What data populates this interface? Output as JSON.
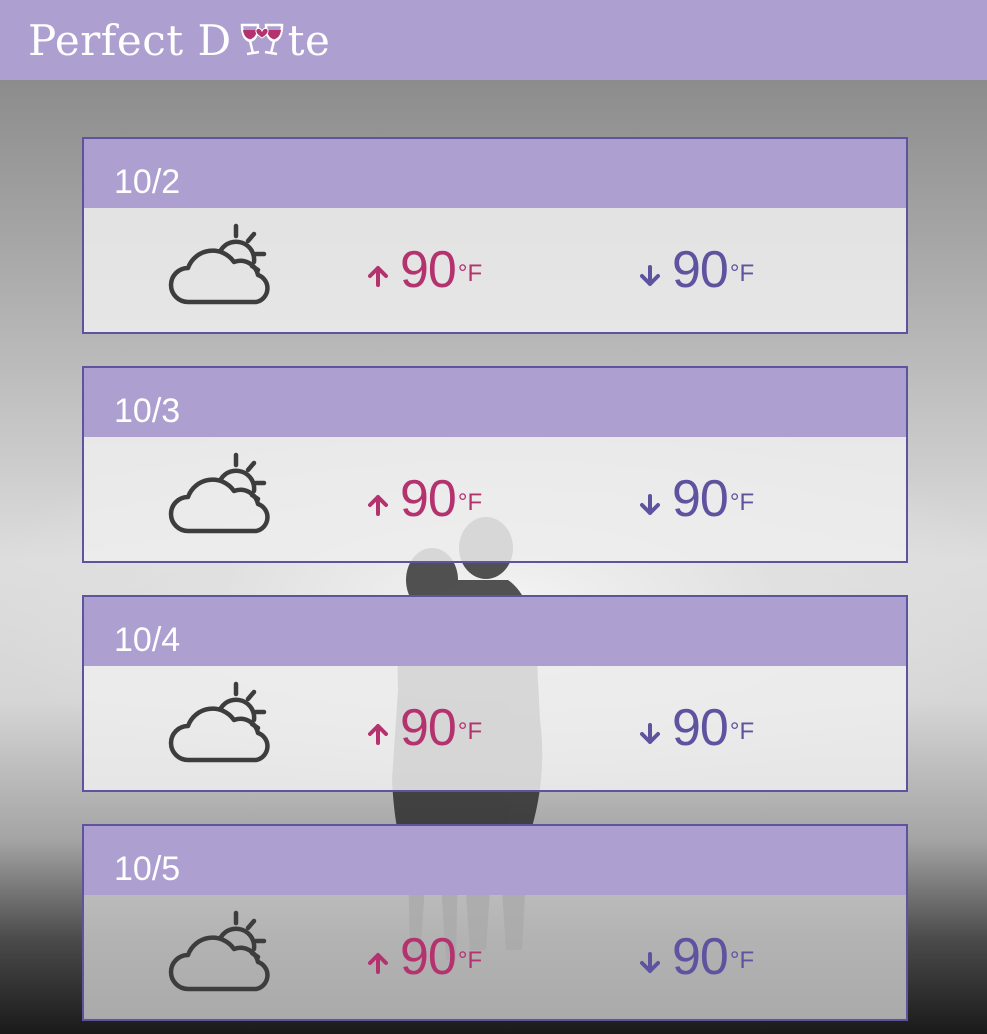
{
  "header": {
    "logo_text_left": "Perfect D",
    "logo_text_right": "te",
    "logo_mark": "wine-glasses-heart-icon",
    "background_color": "#ad9fd0"
  },
  "colors": {
    "accent": "#ad9fd0",
    "border": "#5e539f",
    "high_temp": "#b4326e",
    "low_temp": "#5e539f"
  },
  "forecast": [
    {
      "date": "10/2",
      "icon": "partly-cloudy-icon",
      "high": "90",
      "high_unit": "°F",
      "low": "90",
      "low_unit": "°F"
    },
    {
      "date": "10/3",
      "icon": "partly-cloudy-icon",
      "high": "90",
      "high_unit": "°F",
      "low": "90",
      "low_unit": "°F"
    },
    {
      "date": "10/4",
      "icon": "partly-cloudy-icon",
      "high": "90",
      "high_unit": "°F",
      "low": "90",
      "low_unit": "°F"
    },
    {
      "date": "10/5",
      "icon": "partly-cloudy-icon",
      "high": "90",
      "high_unit": "°F",
      "low": "90",
      "low_unit": "°F"
    }
  ]
}
